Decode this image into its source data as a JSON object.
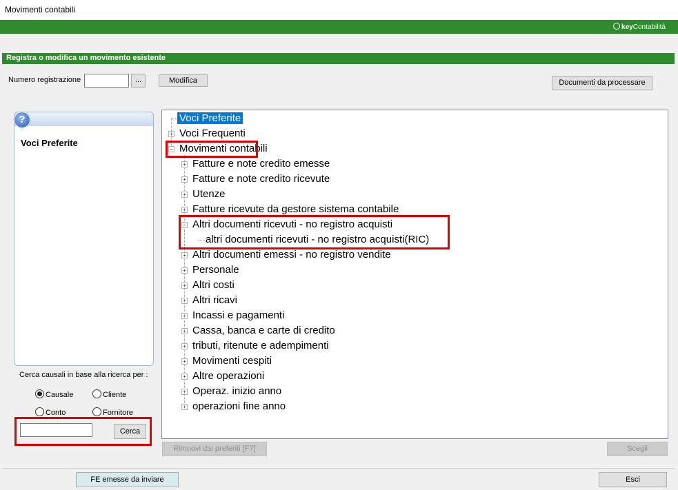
{
  "window": {
    "title": "Movimenti contabili"
  },
  "brand": {
    "bold": "key",
    "normal": "Contabilità"
  },
  "panel": {
    "header": "Registra o modifica un movimento esistente"
  },
  "registration": {
    "label": "Numero registrazione",
    "value": "",
    "browse_label": "...",
    "modify_label": "Modifica"
  },
  "documents_button": "Documenti da processare",
  "left": {
    "help_glyph": "?",
    "title": "Voci Preferite",
    "search_prompt": "Cerca causali in base alla ricerca per :",
    "radios": [
      {
        "label": "Causale",
        "checked": true
      },
      {
        "label": "Cliente",
        "checked": false
      },
      {
        "label": "Conto",
        "checked": false
      },
      {
        "label": "Fornitore",
        "checked": false
      }
    ],
    "search_value": "",
    "search_button": "Cerca"
  },
  "tree": {
    "items": [
      {
        "label": "Voci Preferite",
        "level": 0,
        "expander": "",
        "selected": true
      },
      {
        "label": "Voci Frequenti",
        "level": 0,
        "expander": "+"
      },
      {
        "label": "Movimenti contabili",
        "level": 0,
        "expander": "−"
      },
      {
        "label": "Fatture e note credito emesse",
        "level": 1,
        "expander": "+"
      },
      {
        "label": "Fatture e note credito ricevute",
        "level": 1,
        "expander": "+"
      },
      {
        "label": "Utenze",
        "level": 1,
        "expander": "+"
      },
      {
        "label": "Fatture ricevute da gestore sistema contabile",
        "level": 1,
        "expander": "+"
      },
      {
        "label": "Altri documenti ricevuti - no registro acquisti",
        "level": 1,
        "expander": "−"
      },
      {
        "label": "altri documenti ricevuti - no registro acquisti(RIC)",
        "level": 2,
        "expander": ""
      },
      {
        "label": "Altri documenti emessi - no registro vendite",
        "level": 1,
        "expander": "+"
      },
      {
        "label": "Personale",
        "level": 1,
        "expander": "+"
      },
      {
        "label": "Altri costi",
        "level": 1,
        "expander": "+"
      },
      {
        "label": "Altri ricavi",
        "level": 1,
        "expander": "+"
      },
      {
        "label": "Incassi e pagamenti",
        "level": 1,
        "expander": "+"
      },
      {
        "label": "Cassa, banca e carte di credito",
        "level": 1,
        "expander": "+"
      },
      {
        "label": "tributi, ritenute e adempimenti",
        "level": 1,
        "expander": "+"
      },
      {
        "label": "Movimenti cespiti",
        "level": 1,
        "expander": "+"
      },
      {
        "label": "Altre operazioni",
        "level": 1,
        "expander": "+"
      },
      {
        "label": "Operaz. inizio anno",
        "level": 1,
        "expander": "+"
      },
      {
        "label": "operazioni fine anno",
        "level": 1,
        "expander": "+"
      }
    ]
  },
  "actions": {
    "remove_favorites": "Rimuovi dai preferiti [F7]",
    "choose": "Scegli",
    "fe_to_send": "FE emesse da inviare",
    "exit": "Esci"
  },
  "colors": {
    "brand_green": "#2e8b2e",
    "selection_blue": "#0078d7",
    "highlight_red": "#e00000"
  }
}
